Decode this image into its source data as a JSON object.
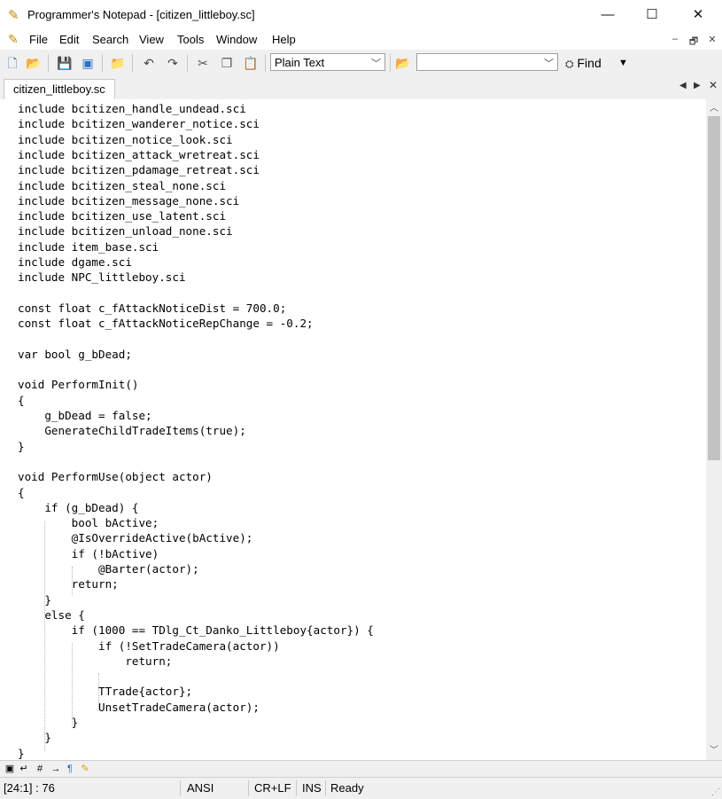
{
  "window": {
    "title": "Programmer's Notepad - [citizen_littleboy.sc]",
    "minimize": "—",
    "maximize": "☐",
    "close": "✕"
  },
  "menu": {
    "items": [
      "File",
      "Edit",
      "Search",
      "View",
      "Tools",
      "Window",
      "Help"
    ],
    "mdi": [
      "–",
      "🗗",
      "✕"
    ]
  },
  "toolbar": {
    "scheme": "Plain Text",
    "search_value": "",
    "find_label": "Find"
  },
  "tabs": {
    "active": "citizen_littleboy.sc"
  },
  "editor": {
    "lines": [
      "include bcitizen_handle_undead.sci",
      "include bcitizen_wanderer_notice.sci",
      "include bcitizen_notice_look.sci",
      "include bcitizen_attack_wretreat.sci",
      "include bcitizen_pdamage_retreat.sci",
      "include bcitizen_steal_none.sci",
      "include bcitizen_message_none.sci",
      "include bcitizen_use_latent.sci",
      "include bcitizen_unload_none.sci",
      "include item_base.sci",
      "include dgame.sci",
      "include NPC_littleboy.sci",
      "",
      "const float c_fAttackNoticeDist = 700.0;",
      "const float c_fAttackNoticeRepChange = -0.2;",
      "",
      "var bool g_bDead;",
      "",
      "void PerformInit()",
      "{",
      "    g_bDead = false;",
      "    GenerateChildTradeItems(true);",
      "}",
      "",
      "void PerformUse(object actor)",
      "{",
      "    if (g_bDead) {",
      "        bool bActive;",
      "        @IsOverrideActive(bActive);",
      "        if (!bActive)",
      "            @Barter(actor);",
      "        return;",
      "    }",
      "    else {",
      "        if (1000 == TDlg_Ct_Danko_Littleboy{actor}) {",
      "            if (!SetTradeCamera(actor))",
      "                return;",
      "",
      "            TTrade{actor};",
      "            UnsetTradeCamera(actor);",
      "        }",
      "    }",
      "}"
    ]
  },
  "status": {
    "position": "[24:1] : 76",
    "encoding": "ANSI",
    "line_endings": "CR+LF",
    "mode": "INS",
    "state": "Ready"
  },
  "icons": [
    "app-icon",
    "new-file-icon",
    "open-folder-icon",
    "save-icon",
    "save-all-icon",
    "open-project-icon",
    "undo-icon",
    "redo-icon",
    "cut-icon",
    "copy-icon",
    "paste-icon",
    "find-in-files-icon",
    "binoculars-icon"
  ]
}
